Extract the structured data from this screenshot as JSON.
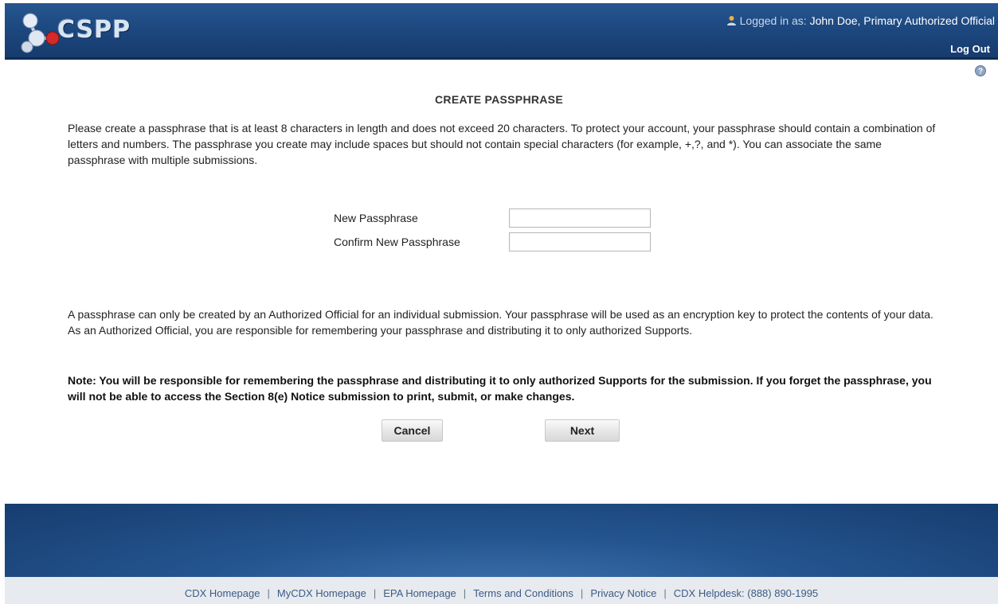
{
  "header": {
    "logo_text": "CSPP",
    "logged_in_prefix": "Logged in as:",
    "user_name": "John Doe, Primary Authorized Official",
    "logout_label": "Log Out"
  },
  "page": {
    "title": "CREATE PASSPHRASE",
    "intro": "Please create a passphrase that is at least 8 characters in length and does not exceed 20 characters. To protect your account, your passphrase should contain a combination of letters and numbers. The passphrase you create may include spaces but should not contain special characters (for example, +,?, and *). You can associate the same passphrase with multiple submissions.",
    "new_passphrase_label": "New Passphrase",
    "new_passphrase_value": "",
    "confirm_passphrase_label": "Confirm New Passphrase",
    "confirm_passphrase_value": "",
    "explanation": "A passphrase can only be created by an Authorized Official for an individual submission. Your passphrase will be used as an encryption key to protect the contents of your data. As an Authorized Official, you are responsible for remembering your passphrase and distributing it to only authorized Supports.",
    "note": "Note: You will be responsible for remembering the passphrase and distributing it to only authorized Supports for the submission. If you forget the passphrase, you will not be able to access the Section 8(e) Notice submission to print, submit, or make changes.",
    "cancel_label": "Cancel",
    "next_label": "Next"
  },
  "footer": {
    "links": [
      "CDX Homepage",
      "MyCDX Homepage",
      "EPA Homepage",
      "Terms and Conditions",
      "Privacy Notice",
      "CDX Helpdesk: (888) 890-1995"
    ],
    "separator": "|"
  },
  "icons": {
    "user": "user-icon",
    "help": "help-icon",
    "logo": "cspp-logo-icon"
  },
  "colors": {
    "header_blue": "#1d4880",
    "footer_link": "#3d5b86"
  }
}
